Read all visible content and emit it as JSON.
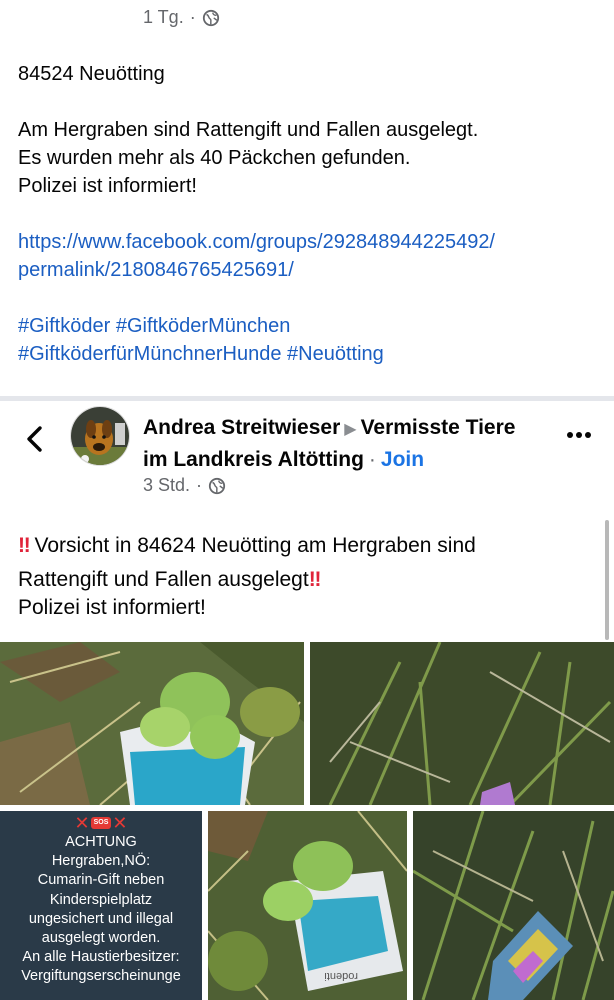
{
  "first_post": {
    "time": "1 Tg.",
    "sep": "·",
    "lines": [
      "84524 Neuötting",
      "",
      "Am Hergraben sind Rattengift und Fallen ausgelegt.",
      "Es wurden mehr als 40 Päckchen gefunden.",
      "Polizei ist informiert!",
      ""
    ],
    "link_lines": [
      "https://www.facebook.com/groups/292848944225492/",
      "permalink/2180846765425691/"
    ],
    "hashtag_lines": [
      "#Giftköder #GiftköderMünchen",
      "#GiftköderfürMünchnerHunde #Neuötting"
    ]
  },
  "shared_post": {
    "author": "Andrea Streitwieser",
    "group": "Vermisste Tiere im Landkreis Altötting",
    "join_label": "Join",
    "time": "3 Std.",
    "sep": "·",
    "text_line1": "Vorsicht in 84624 Neuötting am Hergraben sind",
    "text_line2": "Rattengift und Fallen ausgelegt",
    "text_line3": "Polizei ist informiert!",
    "bang": "‼",
    "icons": {
      "back": "chevron-left-icon",
      "more": "more-icon",
      "globe": "globe-icon",
      "avatar": "dog-avatar"
    }
  },
  "sos_image": {
    "badge": "SOS",
    "lines": [
      "ACHTUNG",
      "Hergraben,NÖ:",
      "Cumarin-Gift neben",
      "Kinderspielplatz",
      "ungesichert und illegal",
      "ausgelegt worden.",
      "An alle Haustierbesitzer:",
      "Vergiftungserscheinunge"
    ]
  },
  "colors": {
    "link": "#1b5ec2",
    "join": "#1b74e4",
    "meta": "#65676b",
    "bang": "#e0243a"
  }
}
